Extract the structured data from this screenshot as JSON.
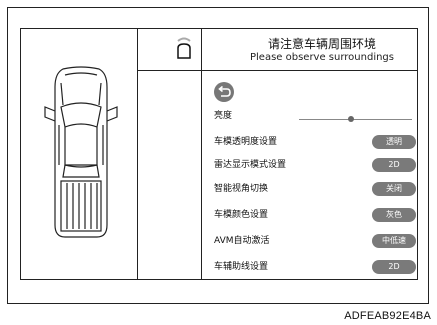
{
  "warning": {
    "title_cn": "请注意车辆周围环境",
    "title_en": "Please observe surroundings"
  },
  "icons": {
    "camera": "camera-icon",
    "back": "back-arrow-icon",
    "car": "car-top-view-icon"
  },
  "brightness": {
    "label": "亮度",
    "level": 0.46
  },
  "settings": [
    {
      "label": "车模透明度设置",
      "value": "透明"
    },
    {
      "label": "雷达显示模式设置",
      "value": "2D"
    },
    {
      "label": "智能视角切换",
      "value": "关闭"
    },
    {
      "label": "车模颜色设置",
      "value": "灰色"
    },
    {
      "label": "AVM自动激活",
      "value": "中低速"
    },
    {
      "label": "车辅助线设置",
      "value": "2D"
    }
  ],
  "footer": {
    "code": "ADFEAB92E4BA"
  },
  "colors": {
    "pill": "#7a7a7a",
    "line": "#222222"
  }
}
